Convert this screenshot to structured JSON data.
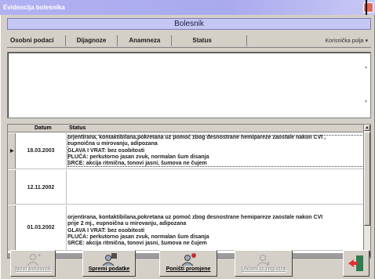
{
  "window": {
    "title": "Evidencija bolesnika"
  },
  "header": {
    "title": "Bolesnik"
  },
  "tabs": [
    {
      "label": "Osobni podaci"
    },
    {
      "label": "Dijagnoze"
    },
    {
      "label": "Anamneza"
    },
    {
      "label": "Status"
    }
  ],
  "user_fields": {
    "label": "Korisnička polja ▾"
  },
  "grid": {
    "columns": {
      "datum": "Datum",
      "status": "Status"
    },
    "rows": [
      {
        "date": "18.03.2003",
        "selected": true,
        "lines": [
          "orjentirana, kontaktibilana,pokretana uz pomoć zbog desnostrane hemipareze zaostale nakon CVI ,",
          "eupnoična u mirovanju, adipozana",
          "GLAVA I VRAT: bez osobitosti",
          "PLUĆA: perkutorno jasan zvuk, normalan šum disanja",
          "SRCE: akcija ritmična, tonovi jasni,  šumova ne čujem"
        ]
      },
      {
        "date": "12.11.2002",
        "selected": false,
        "lines": []
      },
      {
        "date": "01.03.2002",
        "selected": false,
        "lines": [
          "orjentirana, kontaktibilana,pokretana uz pomoć zbog desnostrane hemipareze zaostale nakon CVI",
          "prije 2 mj., eupnoična u mirovanju,  adipozana",
          "GLAVA I VRAT: bez osobitosti",
          "PLUĆA: perkutorno jasan zvuk, normalan šum disanja",
          "SRCE: akcija ritmična, tonovi jasni,  šumova ne čujem"
        ]
      }
    ]
  },
  "toolbar": {
    "new_patient": "Novi bolesnik",
    "save": "Spremi podatke",
    "cancel": "Poništi promjene",
    "remove": "Ukloni iz registra"
  },
  "colors": {
    "title_bar": "#b1b1f2",
    "header_bar": "#c4c6f4",
    "window_bg": "#d4d0c8",
    "exit_icon": "#e03030"
  },
  "icons": {
    "new_patient": "person-add-icon",
    "save": "person-save-icon",
    "cancel": "person-undo-icon",
    "remove": "person-remove-icon",
    "exit": "exit-door-icon"
  }
}
